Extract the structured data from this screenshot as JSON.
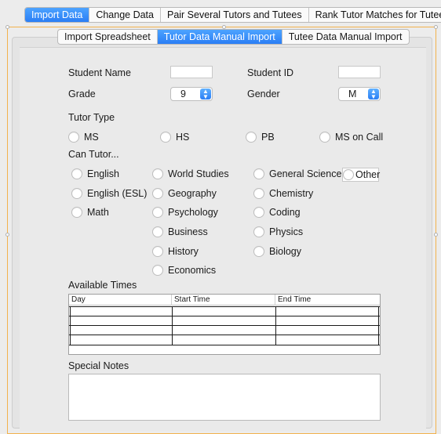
{
  "top_tabs": [
    {
      "label": "Import Data",
      "active": true
    },
    {
      "label": "Change Data",
      "active": false
    },
    {
      "label": "Pair Several Tutors and Tutees",
      "active": false
    },
    {
      "label": "Rank Tutor Matches for Tutee",
      "active": false
    }
  ],
  "sub_tabs": [
    {
      "label": "Import Spreadsheet",
      "active": false
    },
    {
      "label": "Tutor Data Manual Import",
      "active": true
    },
    {
      "label": "Tutee Data Manual Import",
      "active": false
    }
  ],
  "form": {
    "student_name_label": "Student Name",
    "student_name_value": "",
    "student_id_label": "Student ID",
    "student_id_value": "",
    "grade_label": "Grade",
    "grade_value": "9",
    "gender_label": "Gender",
    "gender_value": "M",
    "tutor_type_label": "Tutor Type",
    "tutor_types": [
      "MS",
      "HS",
      "PB",
      "MS on Call"
    ],
    "can_tutor_label": "Can Tutor...",
    "subjects_col1": [
      "English",
      "English (ESL)",
      "Math"
    ],
    "subjects_col2": [
      "World Studies",
      "Geography",
      "Psychology",
      "Business",
      "History",
      "Economics"
    ],
    "subjects_col3": [
      "General Science",
      "Chemistry",
      "Coding",
      "Physics",
      "Biology"
    ],
    "other_label": "Other",
    "available_times_label": "Available Times",
    "table_headers": [
      "Day",
      "Start Time",
      "End Time"
    ],
    "special_notes_label": "Special Notes",
    "special_notes_value": ""
  },
  "colors": {
    "accent": "#2a7ef5",
    "selection_frame": "#f2b24d"
  }
}
